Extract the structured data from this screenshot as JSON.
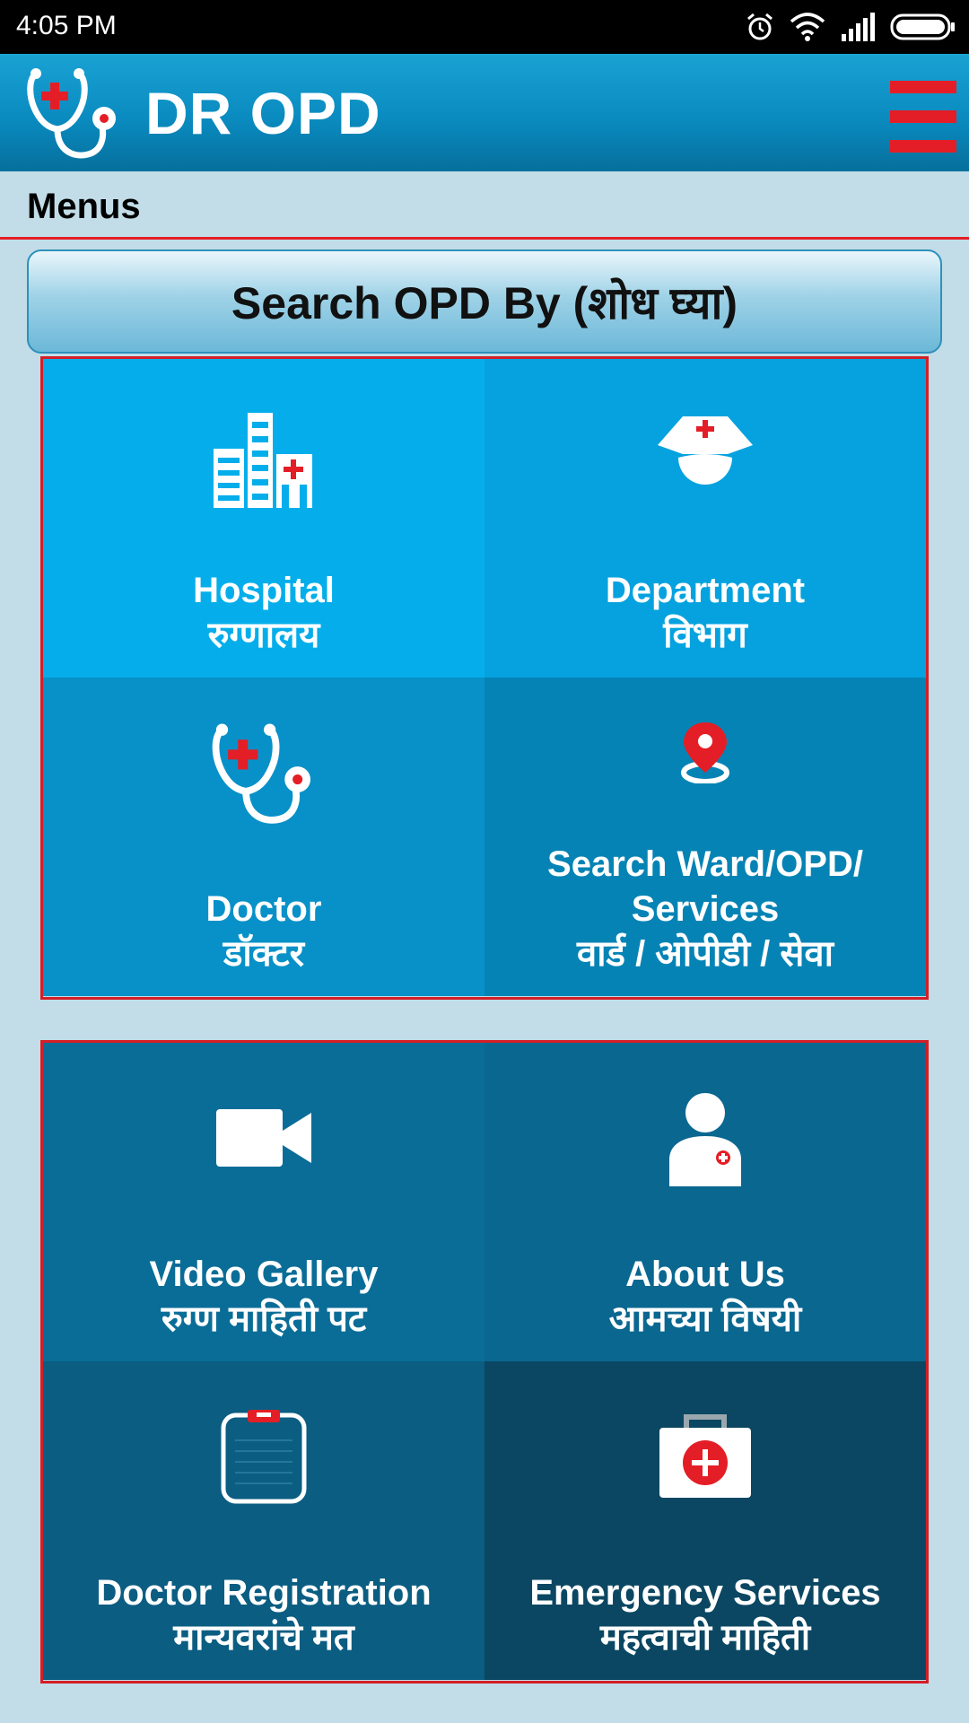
{
  "status_bar": {
    "time": "4:05 PM"
  },
  "app_bar": {
    "title": "DR OPD"
  },
  "menus_label": "Menus",
  "search_banner": "Search OPD By  (शोध  घ्या)",
  "colors": {
    "accent_red": "#e41e26",
    "tile_light": "#05aeeb",
    "tile_dark": "#0b4762",
    "background": "#c2dde8"
  },
  "grid1": [
    {
      "icon": "hospital-building-icon",
      "en": "Hospital",
      "mr": "रुग्णालय"
    },
    {
      "icon": "nurse-cap-icon",
      "en": "Department",
      "mr": "विभाग"
    },
    {
      "icon": "stethoscope-icon",
      "en": "Doctor",
      "mr": "डॉक्टर"
    },
    {
      "icon": "location-pin-icon",
      "en": "Search Ward/OPD/ Services",
      "mr": "वार्ड / ओपीडी / सेवा"
    }
  ],
  "grid2": [
    {
      "icon": "video-camera-icon",
      "en": "Video Gallery",
      "mr": "रुग्ण  माहिती  पट"
    },
    {
      "icon": "user-medical-icon",
      "en": "About Us",
      "mr": "आमच्या  विषयी"
    },
    {
      "icon": "clipboard-icon",
      "en": "Doctor Registration",
      "mr": "मान्यवरांचे  मत"
    },
    {
      "icon": "first-aid-kit-icon",
      "en": "Emergency Services",
      "mr": "महत्वाची  माहिती"
    }
  ]
}
